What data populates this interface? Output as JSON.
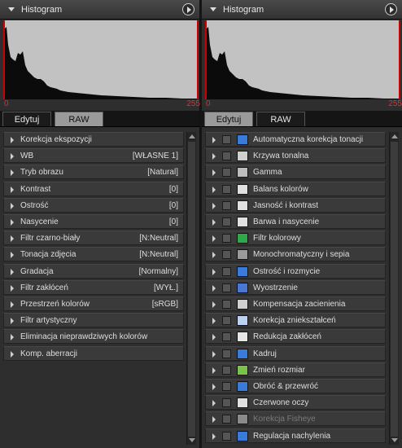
{
  "left": {
    "histogram": {
      "title": "Histogram",
      "range_low": "0",
      "range_high": "255"
    },
    "tabs": {
      "edit": "Edytuj",
      "raw": "RAW",
      "active": "raw"
    },
    "rows": [
      {
        "label": "Korekcja ekspozycji",
        "value": ""
      },
      {
        "label": "WB",
        "value": "[WŁASNE 1]"
      },
      {
        "label": "Tryb obrazu",
        "value": "[Natural]"
      },
      {
        "label": "Kontrast",
        "value": "[0]"
      },
      {
        "label": "Ostrość",
        "value": "[0]"
      },
      {
        "label": "Nasycenie",
        "value": "[0]"
      },
      {
        "label": "Filtr czarno-biały",
        "value": "[N:Neutral]"
      },
      {
        "label": "Tonacja zdjęcia",
        "value": "[N:Neutral]"
      },
      {
        "label": "Gradacja",
        "value": "[Normalny]"
      },
      {
        "label": "Filtr zakłóceń",
        "value": "[WYŁ.]"
      },
      {
        "label": "Przestrzeń kolorów",
        "value": "[sRGB]"
      },
      {
        "label": "Filtr artystyczny",
        "value": ""
      },
      {
        "label": "Eliminacja nieprawdziwych kolorów",
        "value": ""
      },
      {
        "label": "Komp. aberracji",
        "value": ""
      }
    ]
  },
  "right": {
    "histogram": {
      "title": "Histogram",
      "range_low": "0",
      "range_high": "255"
    },
    "tabs": {
      "edit": "Edytuj",
      "raw": "RAW",
      "active": "edit"
    },
    "rows": [
      {
        "label": "Automatyczna korekcja tonacji",
        "icon": "auto-tone-icon",
        "color": "#3a7ad8",
        "disabled": false
      },
      {
        "label": "Krzywa tonalna",
        "icon": "tone-curve-icon",
        "color": "#cfcfcf",
        "disabled": false
      },
      {
        "label": "Gamma",
        "icon": "gamma-icon",
        "color": "#bcbcbc",
        "disabled": false
      },
      {
        "label": "Balans kolorów",
        "icon": "color-balance-icon",
        "color": "#e0e0e0",
        "disabled": false
      },
      {
        "label": "Jasność i kontrast",
        "icon": "brightness-contrast-icon",
        "color": "#e0e0e0",
        "disabled": false
      },
      {
        "label": "Barwa i nasycenie",
        "icon": "hue-saturation-icon",
        "color": "#e0e0e0",
        "disabled": false
      },
      {
        "label": "Filtr kolorowy",
        "icon": "color-filter-icon",
        "color": "#2fa84a",
        "disabled": false
      },
      {
        "label": "Monochromatyczny i sepia",
        "icon": "monochrome-sepia-icon",
        "color": "#9a9a9a",
        "disabled": false
      },
      {
        "label": "Ostrość i rozmycie",
        "icon": "sharpness-blur-icon",
        "color": "#3a7ad8",
        "disabled": false
      },
      {
        "label": "Wyostrzenie",
        "icon": "sharpen-icon",
        "color": "#4a78d0",
        "disabled": false
      },
      {
        "label": "Kompensacja zacienienia",
        "icon": "shading-compensation-icon",
        "color": "#d0d0d0",
        "disabled": false
      },
      {
        "label": "Korekcja zniekształceń",
        "icon": "distortion-correction-icon",
        "color": "#bcd2f0",
        "disabled": false
      },
      {
        "label": "Redukcja zakłóceń",
        "icon": "noise-reduction-icon",
        "color": "#e6e6e6",
        "disabled": false
      },
      {
        "label": "Kadruj",
        "icon": "crop-icon",
        "color": "#3a7ad8",
        "disabled": false
      },
      {
        "label": "Zmień rozmiar",
        "icon": "resize-icon",
        "color": "#7ac24a",
        "disabled": false
      },
      {
        "label": "Obróć & przewróć",
        "icon": "rotate-flip-icon",
        "color": "#3a7ad8",
        "disabled": false
      },
      {
        "label": "Czerwone oczy",
        "icon": "red-eye-icon",
        "color": "#e0e0e0",
        "disabled": false
      },
      {
        "label": "Korekcja Fisheye",
        "icon": "fisheye-icon",
        "color": "#8a8a8a",
        "disabled": true
      },
      {
        "label": "Regulacja nachylenia",
        "icon": "tilt-adjust-icon",
        "color": "#3a7ad8",
        "disabled": false
      }
    ]
  }
}
